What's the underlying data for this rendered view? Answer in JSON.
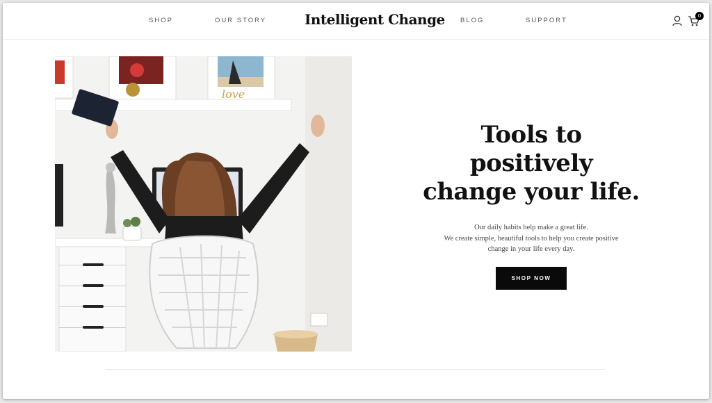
{
  "header": {
    "brand": "Intelligent Change",
    "nav_left": [
      "SHOP",
      "OUR STORY"
    ],
    "nav_right": [
      "BLOG",
      "SUPPORT"
    ],
    "cart_count": "0",
    "icons": [
      "user-icon",
      "cart-icon"
    ]
  },
  "hero": {
    "title_lines": [
      "Tools to",
      "positively",
      "change your life."
    ],
    "subtitle_lines": [
      "Our daily habits help make a great life.",
      "We create simple, beautiful tools to help you create positive",
      "change in your life every day."
    ],
    "cta_label": "SHOP NOW",
    "image_accent": "love"
  },
  "colors": {
    "text_dark": "#111111",
    "button_bg": "#0a0a0a",
    "button_text": "#ffffff",
    "nav_text": "#555555"
  }
}
